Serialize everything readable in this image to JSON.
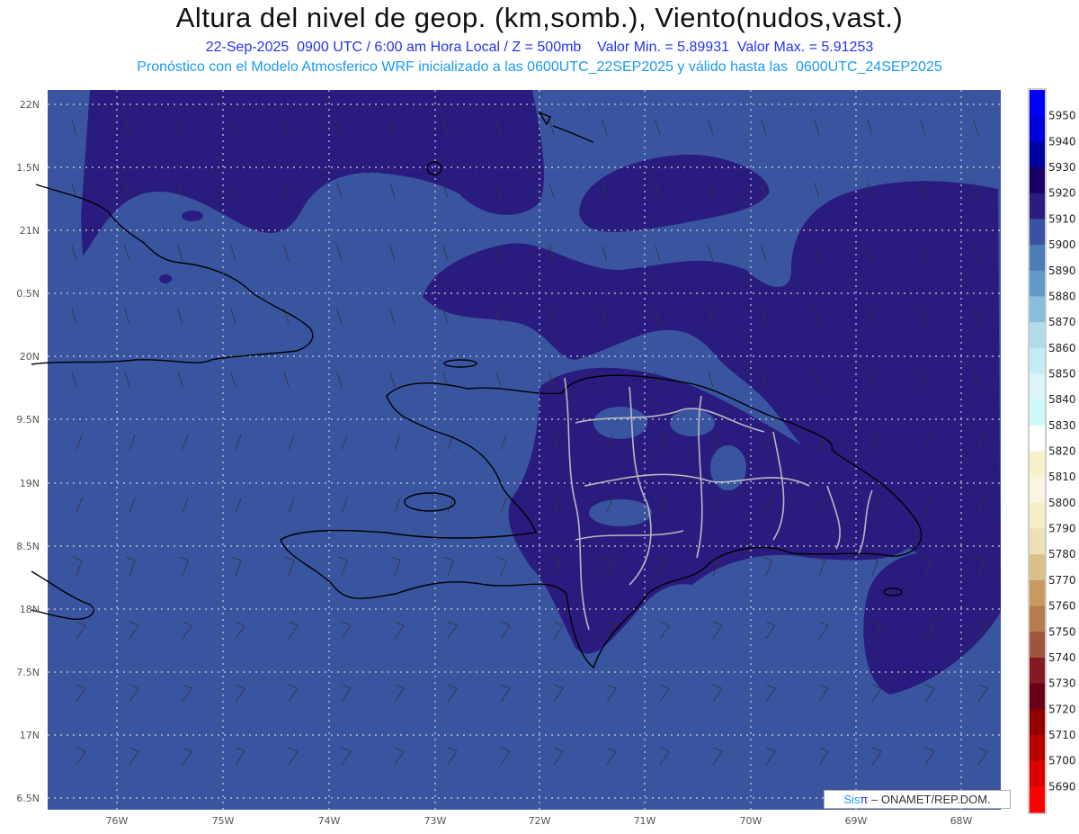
{
  "header": {
    "title": "Altura del nivel de geop. (km,somb.), Viento(nudos,vast.)",
    "subtitle": "22-Sep-2025  0900 UTC / 6:00 am Hora Local / Z = 500mb    Valor Min. = 5.89931  Valor Max. = 5.91253",
    "info": "Pronóstico con el Modelo Atmosferico WRF inicializado a las 0600UTC_22SEP2025 y válido hasta las  0600UTC_24SEP2025"
  },
  "map": {
    "lon_labels": [
      "76W",
      "75W",
      "74W",
      "73W",
      "72W",
      "71W",
      "70W",
      "69W",
      "68W"
    ],
    "lat_labels": [
      "22N",
      "1.5N",
      "21N",
      "0.5N",
      "20N",
      "9.5N",
      "19N",
      "8.5N",
      "18N",
      "7.5N",
      "17N",
      "6.5N"
    ],
    "colors": {
      "base": "#3a55a0",
      "dark": "#2a1c7e",
      "coast": "#000000",
      "provinces": "#b8b8c0"
    }
  },
  "colorbar": {
    "labels": [
      "5950",
      "5940",
      "5930",
      "5920",
      "5910",
      "5900",
      "5890",
      "5880",
      "5870",
      "5860",
      "5850",
      "5840",
      "5830",
      "5820",
      "5810",
      "5800",
      "5790",
      "5780",
      "5770",
      "5760",
      "5750",
      "5740",
      "5730",
      "5720",
      "5710",
      "5700",
      "5690"
    ],
    "colors": [
      "#0000ff",
      "#0000dd",
      "#00009e",
      "#1a0066",
      "#2a1c7e",
      "#3a52a0",
      "#4a7cb8",
      "#6099c8",
      "#88bedc",
      "#b0dcea",
      "#c4ecf4",
      "#dcf4f8",
      "#ccfafc",
      "#ffffff",
      "#f8f2cc",
      "#faf4e2",
      "#f6ecc6",
      "#ece0b4",
      "#dcc08c",
      "#c89a62",
      "#b87c4c",
      "#a05438",
      "#861a24",
      "#6a0018",
      "#920000",
      "#b80000",
      "#da0000",
      "#ff0000"
    ]
  },
  "credit": {
    "sis": "Sis",
    "pi": "π",
    "text": " – ONAMET/REP.DOM."
  }
}
